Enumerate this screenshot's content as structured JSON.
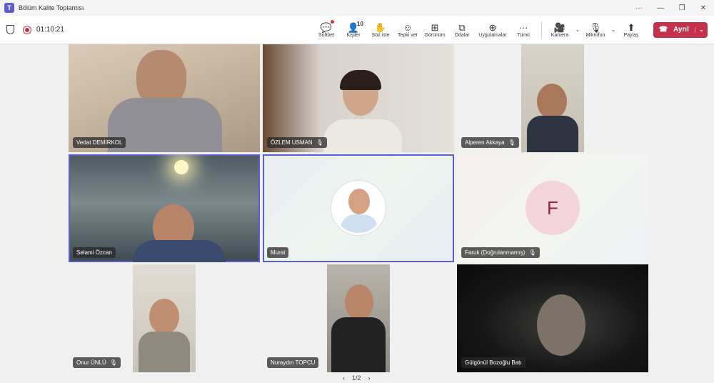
{
  "window": {
    "title": "Bölüm Kalite Toplantısı",
    "controls": [
      "···",
      "—",
      "❐",
      "✕"
    ]
  },
  "toolbar": {
    "timer": "01:10:21",
    "tools": [
      {
        "name": "chat",
        "label": "Sohbet",
        "icon": "💬"
      },
      {
        "name": "people",
        "label": "Kişiler",
        "icon": "👤",
        "count": "10"
      },
      {
        "name": "raise-hand",
        "label": "Söz iste",
        "icon": "✋"
      },
      {
        "name": "react",
        "label": "Tepki ver",
        "icon": "☺"
      },
      {
        "name": "view",
        "label": "Görünüm",
        "icon": "⊞"
      },
      {
        "name": "rooms",
        "label": "Odalar",
        "icon": "⧉"
      },
      {
        "name": "apps",
        "label": "Uygulamalar",
        "icon": "⊕"
      },
      {
        "name": "more",
        "label": "Tümü",
        "icon": "···"
      }
    ],
    "camera": {
      "label": "Kamera",
      "icon": "🎥"
    },
    "mic": {
      "label": "Mikrofon",
      "icon": "🎙"
    },
    "share": {
      "label": "Paylaş",
      "icon": "⬆"
    },
    "leave": {
      "label": "Ayrıl",
      "color": "#c4314b"
    }
  },
  "participants": [
    {
      "name": "Vedat DEMİRKOL",
      "muted": false
    },
    {
      "name": "ÖZLEM USMAN",
      "muted": true
    },
    {
      "name": "Alperen Akkaya",
      "muted": true
    },
    {
      "name": "Selami Özcan",
      "muted": false
    },
    {
      "name": "Murat",
      "muted": false
    },
    {
      "name": "Faruk (Doğrulanmamış)",
      "muted": true,
      "initial": "F"
    },
    {
      "name": "Onur ÜNLÜ",
      "muted": true
    },
    {
      "name": "Nuraydın TOPCU",
      "muted": false
    },
    {
      "name": "Gülgönül Bozoğlu Batı",
      "muted": false
    }
  ],
  "pager": {
    "prev": "‹",
    "text": "1/2",
    "next": "›"
  },
  "colors": {
    "accent": "#5b5fc7",
    "leave": "#c4314b"
  }
}
